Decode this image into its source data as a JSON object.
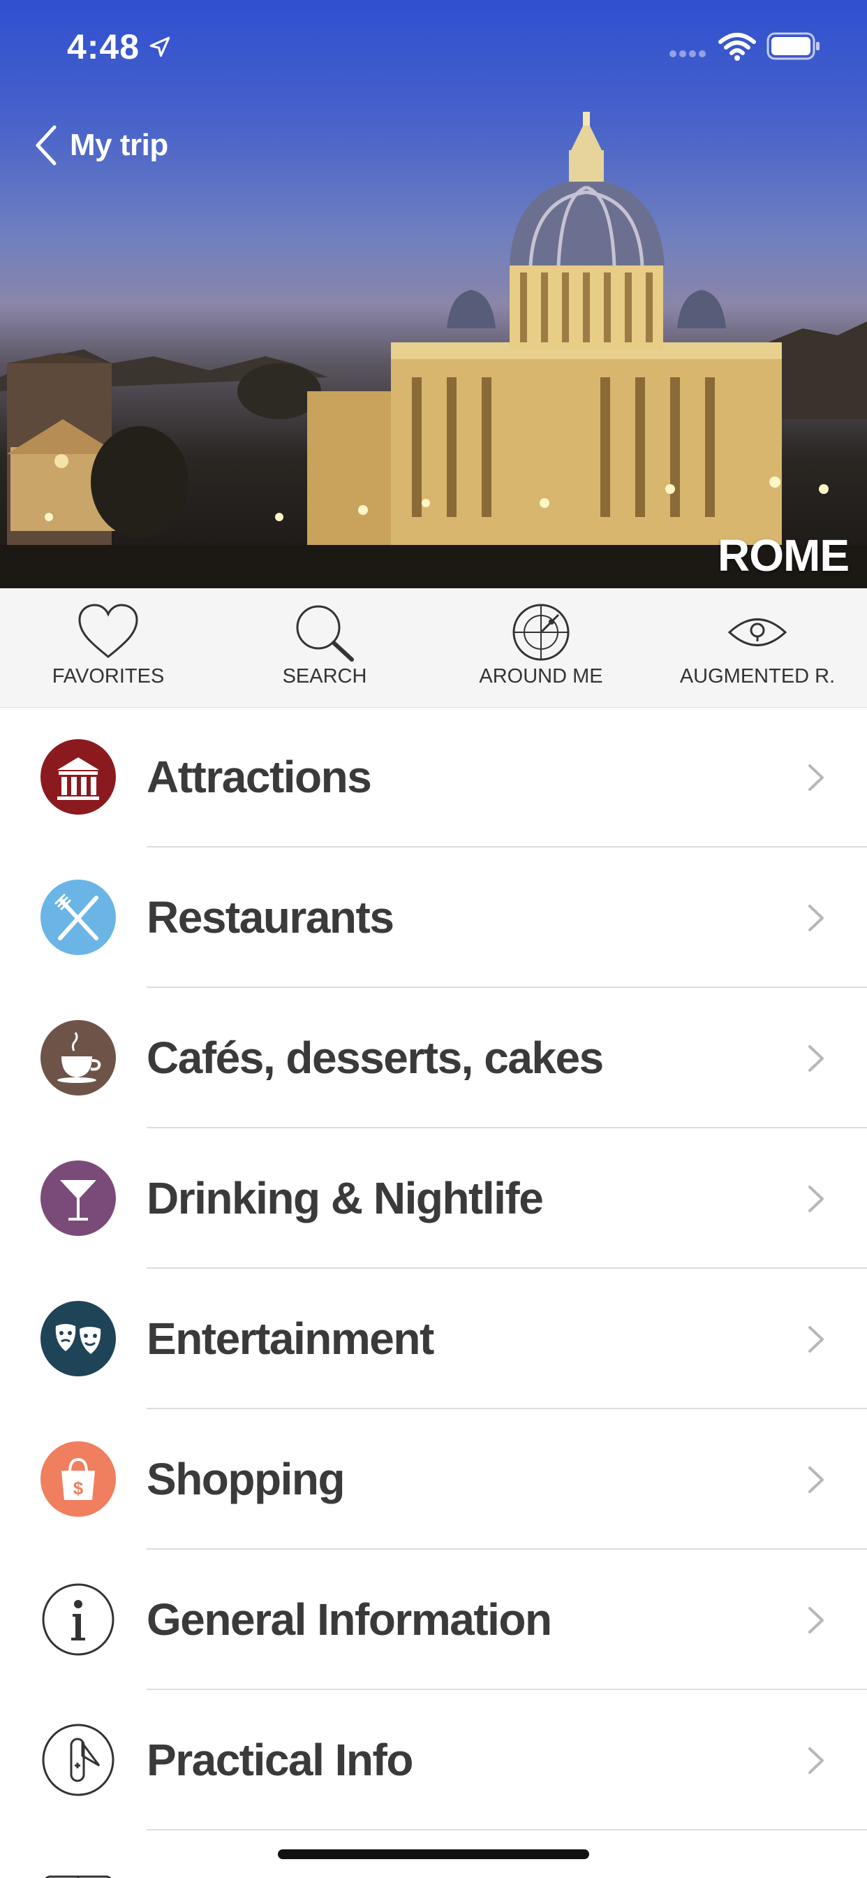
{
  "status_bar": {
    "time": "4:48"
  },
  "nav": {
    "back_label": "My trip"
  },
  "hero": {
    "city": "ROME"
  },
  "toolbar": {
    "items": [
      {
        "label": "FAVORITES",
        "icon": "heart-icon"
      },
      {
        "label": "SEARCH",
        "icon": "search-icon"
      },
      {
        "label": "AROUND ME",
        "icon": "radar-icon"
      },
      {
        "label": "AUGMENTED R.",
        "icon": "eye-icon"
      }
    ]
  },
  "categories": [
    {
      "label": "Attractions",
      "icon": "museum-icon",
      "color": "#8b1a1f"
    },
    {
      "label": "Restaurants",
      "icon": "fork-knife-icon",
      "color": "#6bb5e6"
    },
    {
      "label": "Cafés, desserts, cakes",
      "icon": "coffee-cup-icon",
      "color": "#6e5349"
    },
    {
      "label": "Drinking & Nightlife",
      "icon": "cocktail-icon",
      "color": "#7a4b78"
    },
    {
      "label": "Entertainment",
      "icon": "theater-masks-icon",
      "color": "#1f4357"
    },
    {
      "label": "Shopping",
      "icon": "shopping-bag-icon",
      "color": "#ef7f5e"
    },
    {
      "label": "General Information",
      "icon": "info-icon",
      "color": "#ffffff"
    },
    {
      "label": "Practical Info",
      "icon": "pocket-knife-icon",
      "color": "#ffffff"
    }
  ]
}
